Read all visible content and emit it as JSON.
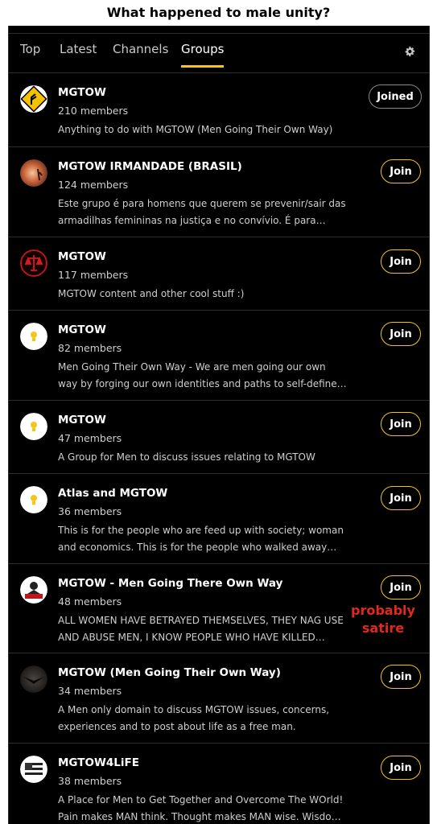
{
  "caption": "What happened to male unity?",
  "tabs": [
    {
      "label": "Top",
      "active": false
    },
    {
      "label": "Latest",
      "active": false
    },
    {
      "label": "Channels",
      "active": false
    },
    {
      "label": "Groups",
      "active": true
    }
  ],
  "settings_icon": "gear-icon",
  "accent_color": "#f5c518",
  "groups": [
    {
      "name": "MGTOW",
      "members": "210 members",
      "description": "Anything to do with MGTOW (Men Going Their Own Way)",
      "button": "Joined",
      "avatar": "yellow-sign-icon"
    },
    {
      "name": "MGTOW IRMANDADE (BRASIL)",
      "members": "124 members",
      "description": "Este grupo é para homens que querem se prevenir/sair das armadilhas femininas na justiça e no convívio. É para homens que",
      "button": "Join",
      "avatar": "sunset-photo-icon"
    },
    {
      "name": "MGTOW",
      "members": "117 members",
      "description": "MGTOW content and other cool stuff :)",
      "button": "Join",
      "avatar": "red-scales-icon"
    },
    {
      "name": "MGTOW",
      "members": "82 members",
      "description": "Men Going Their Own Way - We are men going our own way by forging our own identities and paths to self-defined success.",
      "button": "Join",
      "avatar": "lightbulb-icon"
    },
    {
      "name": "MGTOW",
      "members": "47 members",
      "description": "A Group for Men to discuss issues relating to MGTOW",
      "button": "Join",
      "avatar": "lightbulb-icon"
    },
    {
      "name": "Atlas and MGTOW",
      "members": "36 members",
      "description": "This is for the people who are feed up with society; woman and economics. This is for the people who walked away from it all.",
      "button": "Join",
      "avatar": "lightbulb-icon"
    },
    {
      "name": "MGTOW - Men Going There Own Way",
      "members": "48 members",
      "description": "ALL WOMEN HAVE BETRAYED THEMSELVES, THEY NAG USE AND ABUSE MEN, I KNOW PEOPLE WHO HAVE KILLED THEMSELVES",
      "button": "Join",
      "avatar": "mgtow-logo-icon"
    },
    {
      "name": "MGTOW (Men Going Their Own Way)",
      "members": "34 members",
      "description": "A Men only domain to discuss MGTOW issues, concerns, experiences and to post about life as a free man.",
      "button": "Join",
      "avatar": "dark-figure-icon"
    },
    {
      "name": "MGTOW4LiFE",
      "members": "38 members",
      "description": "A Place for Men to Get Together and Overcome The WOrld! Pain makes MAN think. Thought makes MAN wise. Wisdom makes life",
      "button": "Join",
      "avatar": "flag-emblem-icon"
    }
  ],
  "annotation": "probably satire"
}
